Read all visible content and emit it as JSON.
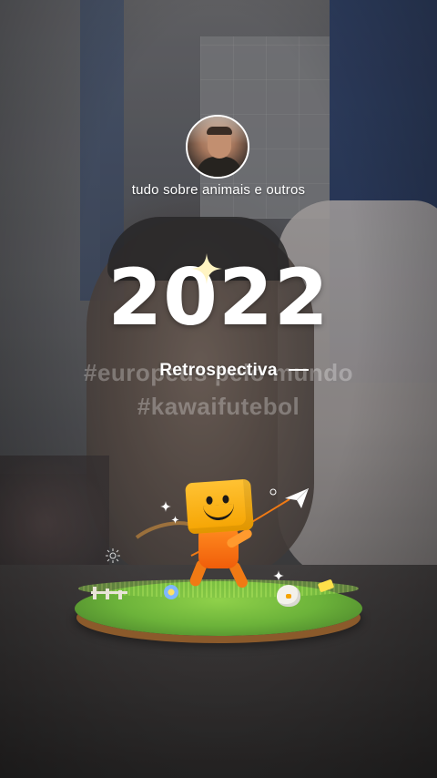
{
  "profile": {
    "caption": "tudo sobre animais e outros"
  },
  "title": {
    "year": "2022",
    "subtitle": "Retrospectiva",
    "ghost_hashtags": [
      "#europeus pelo mundo",
      "#kawaifutebol"
    ]
  },
  "icons": {
    "avatar": "profile-avatar",
    "title_sparkle": "sparkle-icon",
    "paper_plane": "paper-plane-icon",
    "mascot": "mascot-character",
    "sun": "sun-icon"
  },
  "colors": {
    "text": "#ffffff",
    "mascot_head": "#f5a300",
    "mascot_body": "#f05d0a",
    "grass": "#6cb33a",
    "accent_sparkle": "#fff4c2"
  }
}
